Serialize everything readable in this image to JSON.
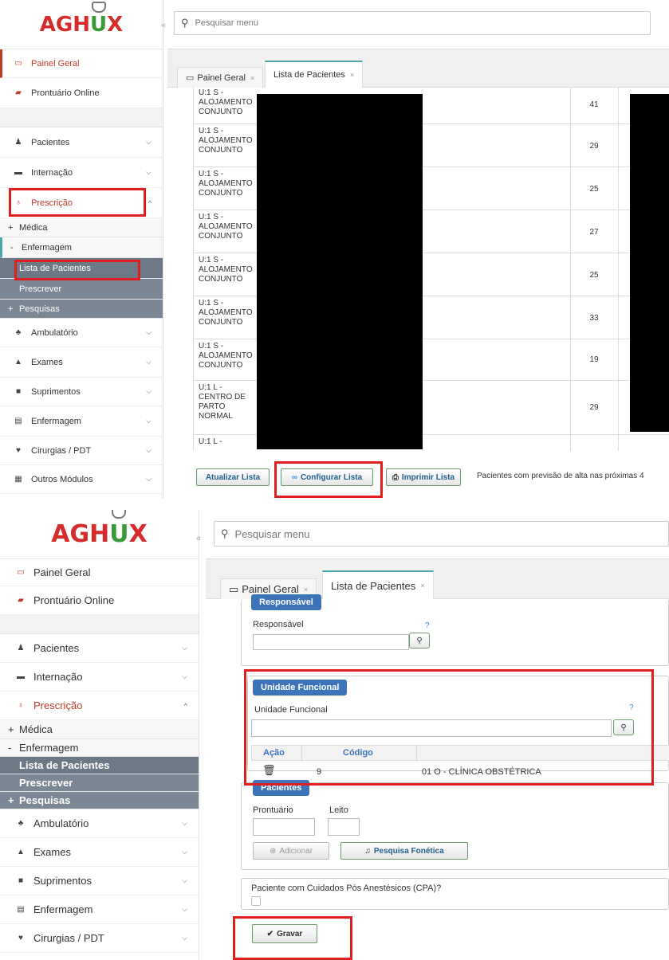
{
  "app": {
    "logo_text_a": "AGH",
    "logo_text_u": "U",
    "logo_text_x": "X",
    "search_placeholder": "Pesquisar menu",
    "collapse_glyph": "«"
  },
  "sidebar": {
    "top_items": [
      {
        "label": "Painel Geral",
        "icon": "monitor-icon"
      },
      {
        "label": "Prontuário Online",
        "icon": "folder-icon"
      }
    ],
    "items": [
      {
        "label": "Pacientes",
        "icon": "user-icon",
        "chevron": "⌵"
      },
      {
        "label": "Internação",
        "icon": "bed-icon",
        "chevron": "⌵"
      },
      {
        "label": "Prescrição",
        "icon": "stethoscope-icon",
        "chevron": "^"
      }
    ],
    "sub_items": [
      {
        "prefix": "+",
        "label": "Médica"
      },
      {
        "prefix": "-",
        "label": "Enfermagem"
      },
      {
        "prefix": "",
        "label": "Lista de Pacientes"
      },
      {
        "prefix": "",
        "label": "Prescrever"
      },
      {
        "prefix": "+",
        "label": "Pesquisas"
      }
    ],
    "bottom_items": [
      {
        "label": "Ambulatório",
        "icon": "users-icon"
      },
      {
        "label": "Exames",
        "icon": "flask-icon"
      },
      {
        "label": "Suprimentos",
        "icon": "box-icon"
      },
      {
        "label": "Enfermagem",
        "icon": "card-icon"
      },
      {
        "label": "Cirurgias / PDT",
        "icon": "heartbeat-icon"
      },
      {
        "label": "Outros Módulos",
        "icon": "grid-icon"
      }
    ]
  },
  "tabs": [
    {
      "label": "Painel Geral",
      "close": "×"
    },
    {
      "label": "Lista de Pacientes",
      "close": "×"
    }
  ],
  "patients_table": {
    "rows": [
      {
        "unit": "U:1 S - ALOJAMENTO CONJUNTO",
        "value": "41"
      },
      {
        "unit": "U:1 S - ALOJAMENTO CONJUNTO",
        "value": "29"
      },
      {
        "unit": "U:1 S - ALOJAMENTO CONJUNTO",
        "value": "25"
      },
      {
        "unit": "U:1 S - ALOJAMENTO CONJUNTO",
        "value": "27"
      },
      {
        "unit": "U:1 S - ALOJAMENTO CONJUNTO",
        "value": "25"
      },
      {
        "unit": "U:1 S - ALOJAMENTO CONJUNTO",
        "value": "33"
      },
      {
        "unit": "U:1 S - ALOJAMENTO CONJUNTO",
        "value": "19"
      },
      {
        "unit": "U:1 L - CENTRO DE PARTO NORMAL",
        "value": "29"
      },
      {
        "unit": "U:1 L -",
        "value": ""
      }
    ]
  },
  "list_actions": {
    "refresh": "Atualizar Lista",
    "configure": "Configurar Lista",
    "print": "Imprimir Lista",
    "discharge_note": "Pacientes com previsão de alta nas próximas 4"
  },
  "config_form": {
    "responsavel": {
      "legend": "Responsável",
      "label": "Responsável",
      "help": "?"
    },
    "unidade": {
      "legend": "Unidade Funcional",
      "label": "Unidade Funcional",
      "help": "?",
      "col_action": "Ação",
      "col_code": "Código",
      "row_code": "9",
      "row_desc": "01 O - CLÍNICA OBSTÉTRICA"
    },
    "pacientes": {
      "legend": "Pacientes",
      "label_prontuario": "Prontuário",
      "label_leito": "Leito",
      "add_button": "Adicionar",
      "phonetic_button": "Pesquisa Fonética"
    },
    "cpa_question": "Paciente com Cuidados Pós Anestésicos (CPA)?",
    "save_button": "Gravar"
  },
  "colors": {
    "highlight": "#e02020",
    "legend_blue": "#3d73b8",
    "logo_red": "#d62b2b",
    "logo_green": "#3a9a3a"
  }
}
